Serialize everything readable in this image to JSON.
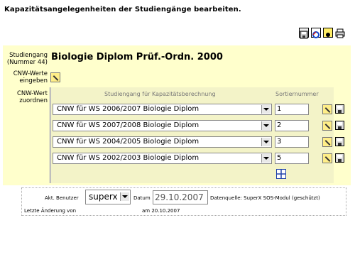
{
  "page": {
    "title": "Kapazitätsangelegenheiten der Studiengänge bearbeiten."
  },
  "toolbar": {
    "icons": [
      "save-icon",
      "refresh-icon",
      "record-icon",
      "print-icon"
    ]
  },
  "labels": {
    "studiengang": "Studiengang",
    "nummer": "(Nummer 44)",
    "cnw_werte_line1": "CNW-Werte",
    "cnw_werte_line2": "eingeben",
    "cnw_wert_line1": "CNW-Wert",
    "cnw_wert_line2": "zuordnen"
  },
  "program": {
    "title": "Biologie Diplom Prüf.-Ordn. 2000"
  },
  "table": {
    "headers": {
      "program": "Studiengang für Kapazitätsberechnung",
      "sort": "Sortiernummer"
    },
    "rows": [
      {
        "program": "CNW für WS 2006/2007 Biologie Diplom",
        "sort": "1"
      },
      {
        "program": "CNW für WS 2007/2008 Biologie Diplom",
        "sort": "2"
      },
      {
        "program": "CNW für WS 2004/2005 Biologie Diplom",
        "sort": "3"
      },
      {
        "program": "CNW für WS 2002/2003 Biologie Diplom",
        "sort": "5"
      }
    ]
  },
  "footer": {
    "user_label": "Akt. Benutzer",
    "user_value": "superx",
    "date_label": "Datum",
    "date_value": "29.10.2007",
    "source": "Datenquelle: SuperX SOS-Modul (geschützt)",
    "last_change_label": "Letzte Änderung von",
    "last_change_date": "am 20.10.2007"
  }
}
